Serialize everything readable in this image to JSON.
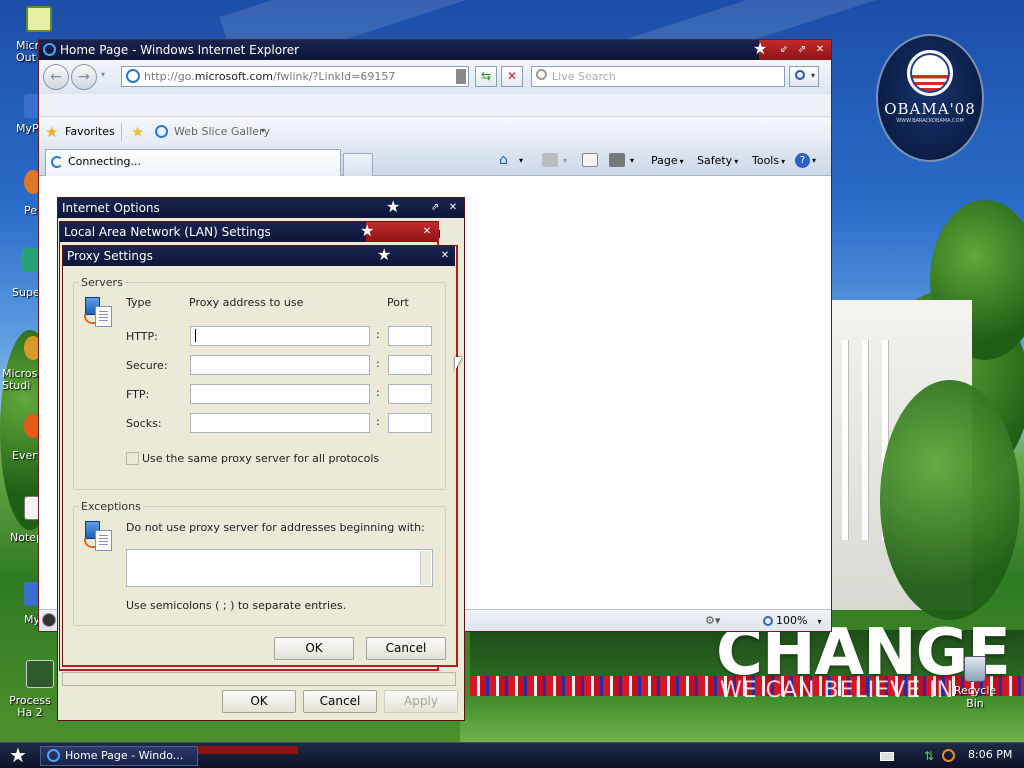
{
  "desktop": {
    "icons": [
      {
        "label": "Micr Out"
      },
      {
        "label": "MyP"
      },
      {
        "label": "Pe"
      },
      {
        "label": "Supe"
      },
      {
        "label": "Microso Studi"
      },
      {
        "label": "Every"
      },
      {
        "label": "Notep"
      },
      {
        "label": "My"
      },
      {
        "label": "Process Ha 2"
      }
    ],
    "recycle_bin": "Recycle Bin",
    "wallpaper": {
      "badge_name": "OBAMA'08",
      "badge_sub": "WWW.BARACKOBAMA.COM",
      "headline": "CHANGE",
      "tagline": "WE CAN BELIEVE IN"
    }
  },
  "ie": {
    "title": "Home Page - Windows Internet Explorer",
    "address": {
      "prefix": "http://go.",
      "domain": "microsoft.com",
      "path": "/fwlink/?LinkId=69157"
    },
    "search_placeholder": "Live Search",
    "favorites": "Favorites",
    "web_slice": "Web Slice Gallery",
    "tab_label": "Connecting...",
    "commands": {
      "page": "Page",
      "safety": "Safety",
      "tools": "Tools"
    },
    "zoom": "100%"
  },
  "internet_options": {
    "title": "Internet Options",
    "buttons": {
      "ok": "OK",
      "cancel": "Cancel",
      "apply": "Apply"
    },
    "peek_char": "d"
  },
  "lan_settings": {
    "title": "Local Area Network (LAN) Settings"
  },
  "proxy": {
    "title": "Proxy Settings",
    "servers_label": "Servers",
    "col_type": "Type",
    "col_address": "Proxy address to use",
    "col_port": "Port",
    "rows": [
      {
        "type": "HTTP:",
        "address": "",
        "port": ""
      },
      {
        "type": "Secure:",
        "address": "",
        "port": ""
      },
      {
        "type": "FTP:",
        "address": "",
        "port": ""
      },
      {
        "type": "Socks:",
        "address": "",
        "port": ""
      }
    ],
    "colon": ":",
    "same_proxy": "Use the same proxy server for all protocols",
    "exceptions_label": "Exceptions",
    "exceptions_desc": "Do not use proxy server for addresses beginning with:",
    "exceptions_value": "",
    "semicolon_hint": "Use semicolons ( ; ) to separate entries.",
    "ok": "OK",
    "cancel": "Cancel"
  },
  "taskbar": {
    "task_ie": "Home Page - Windo...",
    "clock": "8:06 PM"
  },
  "colors": {
    "titlebar": "#0d1638",
    "accent_red": "#b02020",
    "dialog_bg": "#ece9d8"
  }
}
